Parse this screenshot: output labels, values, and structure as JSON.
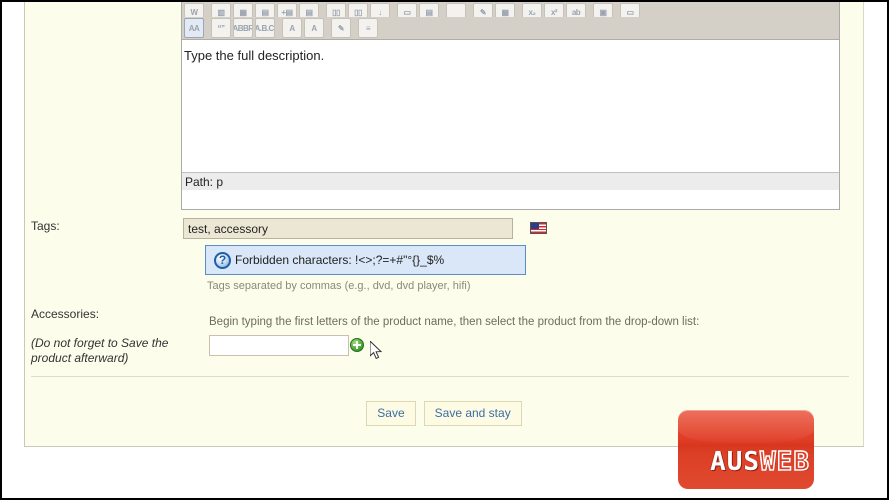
{
  "editor": {
    "toolbar_row1": [
      {
        "name": "paste-word-icon",
        "glyph": "W"
      },
      {
        "name": "insert-table-icon",
        "glyph": "▥"
      },
      {
        "name": "table-properties-icon",
        "glyph": "▦"
      },
      {
        "name": "table-cell-icon",
        "glyph": "▤"
      },
      {
        "name": "insert-row-before-icon",
        "glyph": "+▤"
      },
      {
        "name": "delete-row-icon",
        "glyph": "▤"
      },
      {
        "name": "insert-column-icon",
        "glyph": "▯▯"
      },
      {
        "name": "delete-column-icon",
        "glyph": "▯▯"
      },
      {
        "name": "split-cells-icon",
        "glyph": "↓"
      },
      {
        "name": "merge-cells-icon",
        "glyph": "▭"
      },
      {
        "name": "table-row-props-icon",
        "glyph": "▤"
      },
      {
        "name": "blank-tool-icon",
        "glyph": ""
      },
      {
        "name": "insert-link-icon",
        "glyph": "✎"
      },
      {
        "name": "media-icon",
        "glyph": "▦"
      },
      {
        "name": "subscript-icon",
        "glyph": "x₂"
      },
      {
        "name": "superscript-icon",
        "glyph": "x²"
      },
      {
        "name": "find-replace-icon",
        "glyph": "ab"
      },
      {
        "name": "insert-image-icon",
        "glyph": "▣"
      },
      {
        "name": "horizontal-rule-icon",
        "glyph": "▭"
      }
    ],
    "toolbar_row2": [
      {
        "name": "style-select-icon",
        "glyph": "AA",
        "active": true
      },
      {
        "name": "blockquote-icon",
        "glyph": "“”"
      },
      {
        "name": "abbreviation-icon",
        "glyph": "ABBR"
      },
      {
        "name": "acronym-icon",
        "glyph": "A.B.C."
      },
      {
        "name": "delete-text-icon",
        "glyph": "A"
      },
      {
        "name": "insert-text-icon",
        "glyph": "A"
      },
      {
        "name": "edit-css-icon",
        "glyph": "✎"
      },
      {
        "name": "citation-icon",
        "glyph": "≡"
      }
    ],
    "body_text": "Type the full description.",
    "path_label": "Path: p"
  },
  "form": {
    "tags_label": "Tags:",
    "tags_value": "test, accessory",
    "tags_flag": "us-flag-icon",
    "forbidden_icon_glyph": "?",
    "forbidden_message": "Forbidden characters: !<>;?=+#\"°{}_$%",
    "tags_hint": "Tags separated by commas (e.g., dvd, dvd player, hifi)",
    "accessories_label": "Accessories:",
    "accessories_note": "(Do not forget to Save the product afterward)",
    "accessories_hint": "Begin typing the first letters of the product name, then select the product from the drop-down list:",
    "accessory_value": "",
    "accessory_placeholder": "",
    "add_accessory_icon": "plus-circle-icon"
  },
  "buttons": {
    "save_label": "Save",
    "save_and_stay_label": "Save and stay"
  },
  "logo": {
    "part1": "AUS",
    "part2": "WEB"
  },
  "colors": {
    "panel_bg": "#fdfdec",
    "tags_field_bg": "#ece7d5",
    "info_box_bg": "#d9e7f8",
    "info_box_border": "#5b8dc8",
    "button_text": "#3a6ea5",
    "logo_red": "#e03d26"
  }
}
